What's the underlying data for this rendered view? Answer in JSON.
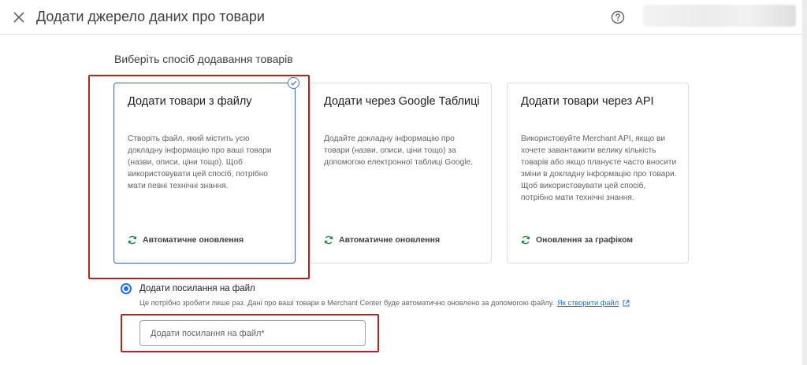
{
  "header": {
    "title": "Додати джерело даних про товари",
    "close_icon": "close-icon",
    "help_icon": "help-icon"
  },
  "main": {
    "section_title": "Виберіть спосіб додавання товарів",
    "cards": [
      {
        "title": "Додати товари з файлу",
        "description": "Створіть файл, який містить усю докладну інформацію про ваші товари (назви, описи, ціни тощо). Щоб використовувати цей спосіб, потрібно мати певні технічні знання.",
        "footer": "Автоматичне оновлення",
        "selected": true
      },
      {
        "title": "Додати через Google Таблиці",
        "description": "Додайте докладну інформацію про товари (назви, описи, ціни тощо) за допомогою електронної таблиці Google.",
        "footer": "Автоматичне оновлення",
        "selected": false
      },
      {
        "title": "Додати товари через API",
        "description": "Використовуйте Merchant API, якщо ви хочете завантажити велику кількість товарів або якщо плануєте часто вносити зміни в докладну інформацію про товари. Щоб використовувати цей спосіб, потрібно мати технічні знання.",
        "footer": "Оновлення за графіком",
        "selected": false
      }
    ],
    "option": {
      "label": "Додати посилання на файл",
      "helper": "Це потрібно зробити лише раз. Дані про ваші товари в Merchant Center буде автоматично оновлено за допомогою файлу.",
      "link": "Як створити файл",
      "input_placeholder": "Додати посилання на файл*"
    }
  },
  "colors": {
    "accent": "#1a73e8",
    "selected_border": "#3f63b8",
    "annotation": "#b3261e",
    "sync_icon": "#188038"
  }
}
